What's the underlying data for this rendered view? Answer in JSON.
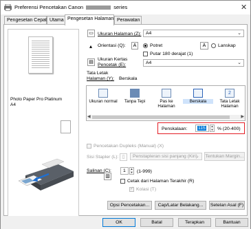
{
  "window": {
    "title_prefix": "Preferensi Pencetakan Canon",
    "title_suffix": "series",
    "close_glyph": "✕"
  },
  "tabs": [
    {
      "label": "Pengesetan Cepat"
    },
    {
      "label": "Utama"
    },
    {
      "label": "Pengesetan Halaman"
    },
    {
      "label": "Perawatan"
    }
  ],
  "preview": {
    "media_line1": "Photo Paper Pro Platinum",
    "media_line2": "A4"
  },
  "page_setup": {
    "page_size_label": "Ukuran Halaman (Z):",
    "page_size_value": "A4",
    "orientation_label": "Orientasi (Q):",
    "portrait_label": "Potret",
    "landscape_label": "Lanskap",
    "orientation_selected": "portrait",
    "rotate_label": "Putar 180 derajat (1)",
    "printer_paper_label_1": "Ukuran Kertas",
    "printer_paper_label_2": "Pencetak (E):",
    "printer_paper_value": "A4",
    "layout_label_1": "Tata Letak",
    "layout_label_2": "Halaman (Y):",
    "layout_current": "Berskala",
    "layout_options": [
      {
        "label": "Ukuran normal"
      },
      {
        "label": "Tanpa Tepi"
      },
      {
        "label": "Pas ke Halaman"
      },
      {
        "label": "Berskala"
      },
      {
        "label": "Tata Letak Halaman"
      }
    ],
    "layout_selected_index": 3,
    "scaling_label": "Penskalaan:",
    "scaling_value": "115",
    "scaling_range": "% (20-400)",
    "duplex_label": "Pencetakan Dupleks (Manual) (X)",
    "stapling_label": "Sisi Stapler (L):",
    "stapling_value": "Penstapleran sisi panjang (Kiri)",
    "margin_button": "Tentukan Margin...",
    "copies_label": "Salinan (C):",
    "copies_value": "1",
    "copies_range": "(1-999)",
    "last_page_label": "Cetak dari Halaman Terakhir (R)",
    "collate_label": "Kolasi (T)",
    "print_options_button": "Opsi Pencetakan...",
    "stamp_button": "Cap/Latar Belakang...",
    "defaults_button": "Setelan Asal (F)"
  },
  "footer": {
    "ok": "OK",
    "cancel": "Batal",
    "apply": "Terapkan",
    "help": "Bantuan"
  },
  "colors": {
    "highlight_border": "#e31b23",
    "selection": "#0078d7"
  }
}
